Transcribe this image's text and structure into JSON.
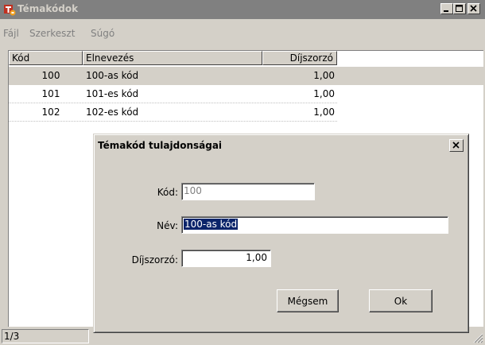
{
  "window": {
    "title": "Témakódok",
    "buttons": {
      "min": "_",
      "max": "□",
      "close": "×"
    }
  },
  "menu": [
    "Fájl",
    "Szerkeszt",
    "Súgó"
  ],
  "list": {
    "columns": [
      "Kód",
      "Elnevezés",
      "Díjszorzó"
    ],
    "rows": [
      {
        "code": "100",
        "name": "100-as kód",
        "multiplier": "1,00"
      },
      {
        "code": "101",
        "name": "101-es kód",
        "multiplier": "1,00"
      },
      {
        "code": "102",
        "name": "102-es kód",
        "multiplier": "1,00"
      }
    ],
    "selected_index": 0
  },
  "status": {
    "position": "1/3"
  },
  "dialog": {
    "title": "Témakód tulajdonságai",
    "fields": {
      "code": {
        "label": "Kód:",
        "value": "100",
        "enabled": false
      },
      "name": {
        "label": "Név:",
        "value": "100-as kód",
        "selected": true
      },
      "multiplier": {
        "label": "Díjszorzó:",
        "value": "1,00"
      }
    },
    "buttons": {
      "cancel": "Mégsem",
      "ok": "Ok"
    }
  },
  "colors": {
    "selection": "#0a246a",
    "face": "#d4d0c8",
    "inactive_title": "#808080"
  }
}
